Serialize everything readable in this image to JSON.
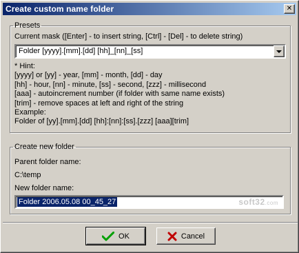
{
  "window": {
    "title": "Create custom name folder",
    "close_glyph": "✕"
  },
  "presets": {
    "legend": "Presets",
    "current_mask_label": "Current mask  ([Enter] - to insert string, [Ctrl] - [Del] - to delete string)",
    "mask_value": "Folder [yyyy].[mm].[dd] [hh]_[nn]_[ss]",
    "hint_lines": [
      "* Hint:",
      "[yyyy] or [yy] - year, [mm] - month, [dd] - day",
      "[hh] - hour, [nn] - minute, [ss] - second, [zzz] - millisecond",
      "[aaa] - autoincrement number (if folder with same name exists)",
      "[trim] - remove spaces at left and right of the string",
      "Example:",
      "Folder of [yy].[mm].[dd] [hh]:[nn]:[ss].[zzz] [aaa][trim]"
    ]
  },
  "new_folder": {
    "legend": "Create new folder",
    "parent_label": "Parent folder name:",
    "parent_value": "C:\\temp",
    "new_label": "New folder name:",
    "new_value": "Folder 2006.05.08 00_45_27",
    "watermark_main": "soft32",
    "watermark_suffix": ".com"
  },
  "buttons": {
    "ok_label": "OK",
    "cancel_label": "Cancel"
  },
  "icons": {
    "ok": "check-icon",
    "cancel": "x-icon",
    "ok_color": "#00a000",
    "cancel_color": "#c00000"
  }
}
